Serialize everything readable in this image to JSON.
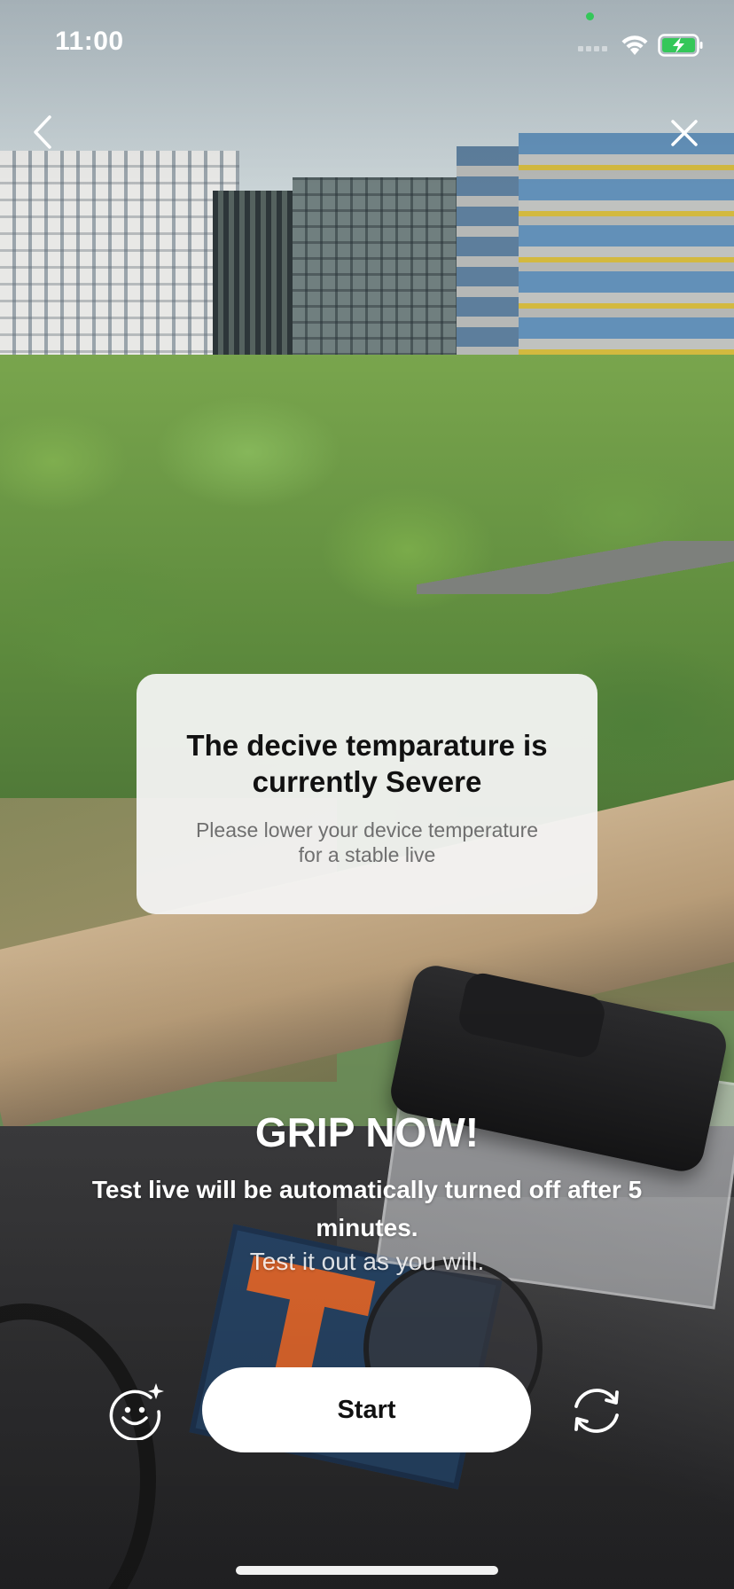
{
  "status_bar": {
    "time": "11:00"
  },
  "nav": {
    "back_icon": "chevron-left-icon",
    "close_icon": "close-icon"
  },
  "dialog": {
    "title": "The decive temparature is currently Severe",
    "message": "Please lower your device temperature for a stable live"
  },
  "promo": {
    "title": "GRIP NOW!",
    "description": "Test live will be automatically turned off after 5 minutes.",
    "subtitle": "Test it out as you will."
  },
  "controls": {
    "effects_icon": "face-sparkle-icon",
    "start_label": "Start",
    "flip_icon": "camera-flip-icon"
  },
  "colors": {
    "button_bg": "#ffffff",
    "dialog_bg": "#f4f4f4",
    "battery_charging": "#34c759",
    "text_light": "#ffffff"
  }
}
